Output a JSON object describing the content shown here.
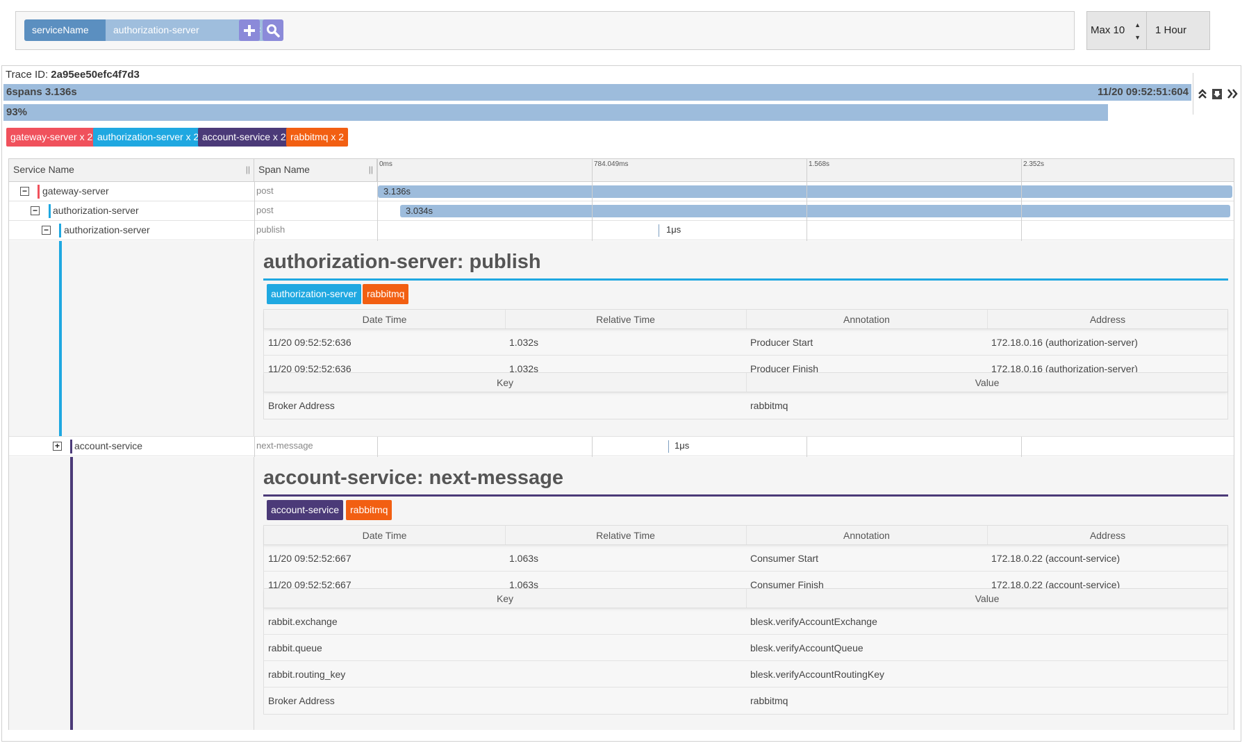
{
  "query": {
    "facet_key": "serviceName",
    "facet_value": "authorization-server",
    "facet_close": "×",
    "limit": "Max 10",
    "lookback": "1 Hour"
  },
  "trace": {
    "id_label": "Trace ID:",
    "id": "2a95ee50efc4f7d3",
    "summary": "6spans 3.136s",
    "timestamp": "11/20 09:52:51:604",
    "percent": "93%",
    "percent_value": 0.93
  },
  "service_tags": [
    {
      "label": "gateway-server x 2",
      "color": "#f0515c"
    },
    {
      "label": "authorization-server x 2",
      "color": "#1fa8e1"
    },
    {
      "label": "account-service x 2",
      "color": "#4b3a78"
    },
    {
      "label": "rabbitmq x 2",
      "color": "#f25f12"
    }
  ],
  "table": {
    "col_service": "Service Name",
    "col_span": "Span Name",
    "ticks": [
      "0ms",
      "784.049ms",
      "1.568s",
      "2.352s"
    ]
  },
  "rows": [
    {
      "service": "gateway-server",
      "span": "post",
      "duration": "3.136s"
    },
    {
      "service": "authorization-server",
      "span": "post",
      "duration": "3.034s"
    },
    {
      "service": "authorization-server",
      "span": "publish",
      "duration": "1μs"
    },
    {
      "service": "account-service",
      "span": "next-message",
      "duration": "1μs"
    }
  ],
  "detail1": {
    "title": "authorization-server: publish",
    "tags": [
      "authorization-server",
      "rabbitmq"
    ],
    "headers": [
      "Date Time",
      "Relative Time",
      "Annotation",
      "Address"
    ],
    "annotations": [
      [
        "11/20 09:52:52:636",
        "1.032s",
        "Producer Start",
        "172.18.0.16 (authorization-server)"
      ],
      [
        "11/20 09:52:52:636",
        "1.032s",
        "Producer Finish",
        "172.18.0.16 (authorization-server)"
      ]
    ],
    "kv_headers": [
      "Key",
      "Value"
    ],
    "kv": [
      [
        "Broker Address",
        "rabbitmq"
      ]
    ]
  },
  "detail2": {
    "title": "account-service: next-message",
    "tags": [
      "account-service",
      "rabbitmq"
    ],
    "headers": [
      "Date Time",
      "Relative Time",
      "Annotation",
      "Address"
    ],
    "annotations": [
      [
        "11/20 09:52:52:667",
        "1.063s",
        "Consumer Start",
        "172.18.0.22 (account-service)"
      ],
      [
        "11/20 09:52:52:667",
        "1.063s",
        "Consumer Finish",
        "172.18.0.22 (account-service)"
      ]
    ],
    "kv_headers": [
      "Key",
      "Value"
    ],
    "kv": [
      [
        "rabbit.exchange",
        "blesk.verifyAccountExchange"
      ],
      [
        "rabbit.queue",
        "blesk.verifyAccountQueue"
      ],
      [
        "rabbit.routing_key",
        "blesk.verifyAccountRoutingKey"
      ],
      [
        "Broker Address",
        "rabbitmq"
      ]
    ]
  }
}
